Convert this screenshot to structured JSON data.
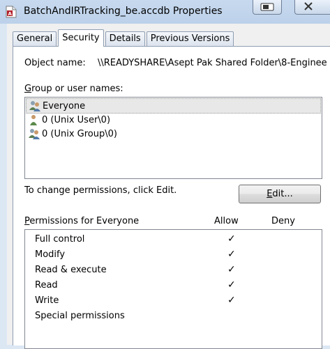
{
  "window": {
    "title": "BatchAndIRTracking_be.accdb Properties"
  },
  "tabs": [
    {
      "label": "General"
    },
    {
      "label": "Security",
      "active": true
    },
    {
      "label": "Details"
    },
    {
      "label": "Previous Versions"
    }
  ],
  "security": {
    "object_name_label": "Object name:",
    "object_name_value": "\\\\READYSHARE\\Asept Pak Shared Folder\\8-Enginee",
    "group_label": "Group or user names:",
    "group_label_access_key": "G",
    "group_label_rest": "roup or user names:",
    "users": [
      {
        "name": "Everyone",
        "icon": "group-users-icon",
        "selected": true
      },
      {
        "name": "0 (Unix User\\0)",
        "icon": "single-user-icon",
        "selected": false
      },
      {
        "name": "0 (Unix Group\\0)",
        "icon": "group-users-icon",
        "selected": false
      }
    ],
    "change_text": "To change permissions, click Edit.",
    "edit_button": "Edit...",
    "edit_access_key": "E",
    "edit_rest": "dit...",
    "permissions_label": "Permissions for Everyone",
    "permissions_access_key": "P",
    "permissions_rest": "ermissions for Everyone",
    "allow_header": "Allow",
    "deny_header": "Deny",
    "permissions": [
      {
        "name": "Full control",
        "allow": "✓",
        "deny": ""
      },
      {
        "name": "Modify",
        "allow": "✓",
        "deny": ""
      },
      {
        "name": "Read & execute",
        "allow": "✓",
        "deny": ""
      },
      {
        "name": "Read",
        "allow": "✓",
        "deny": ""
      },
      {
        "name": "Write",
        "allow": "✓",
        "deny": ""
      },
      {
        "name": "Special permissions",
        "allow": "",
        "deny": ""
      }
    ]
  },
  "colors": {
    "titlebar": "#c7d9ee",
    "panel": "#ffffff",
    "selection": "#e8e8e8"
  }
}
